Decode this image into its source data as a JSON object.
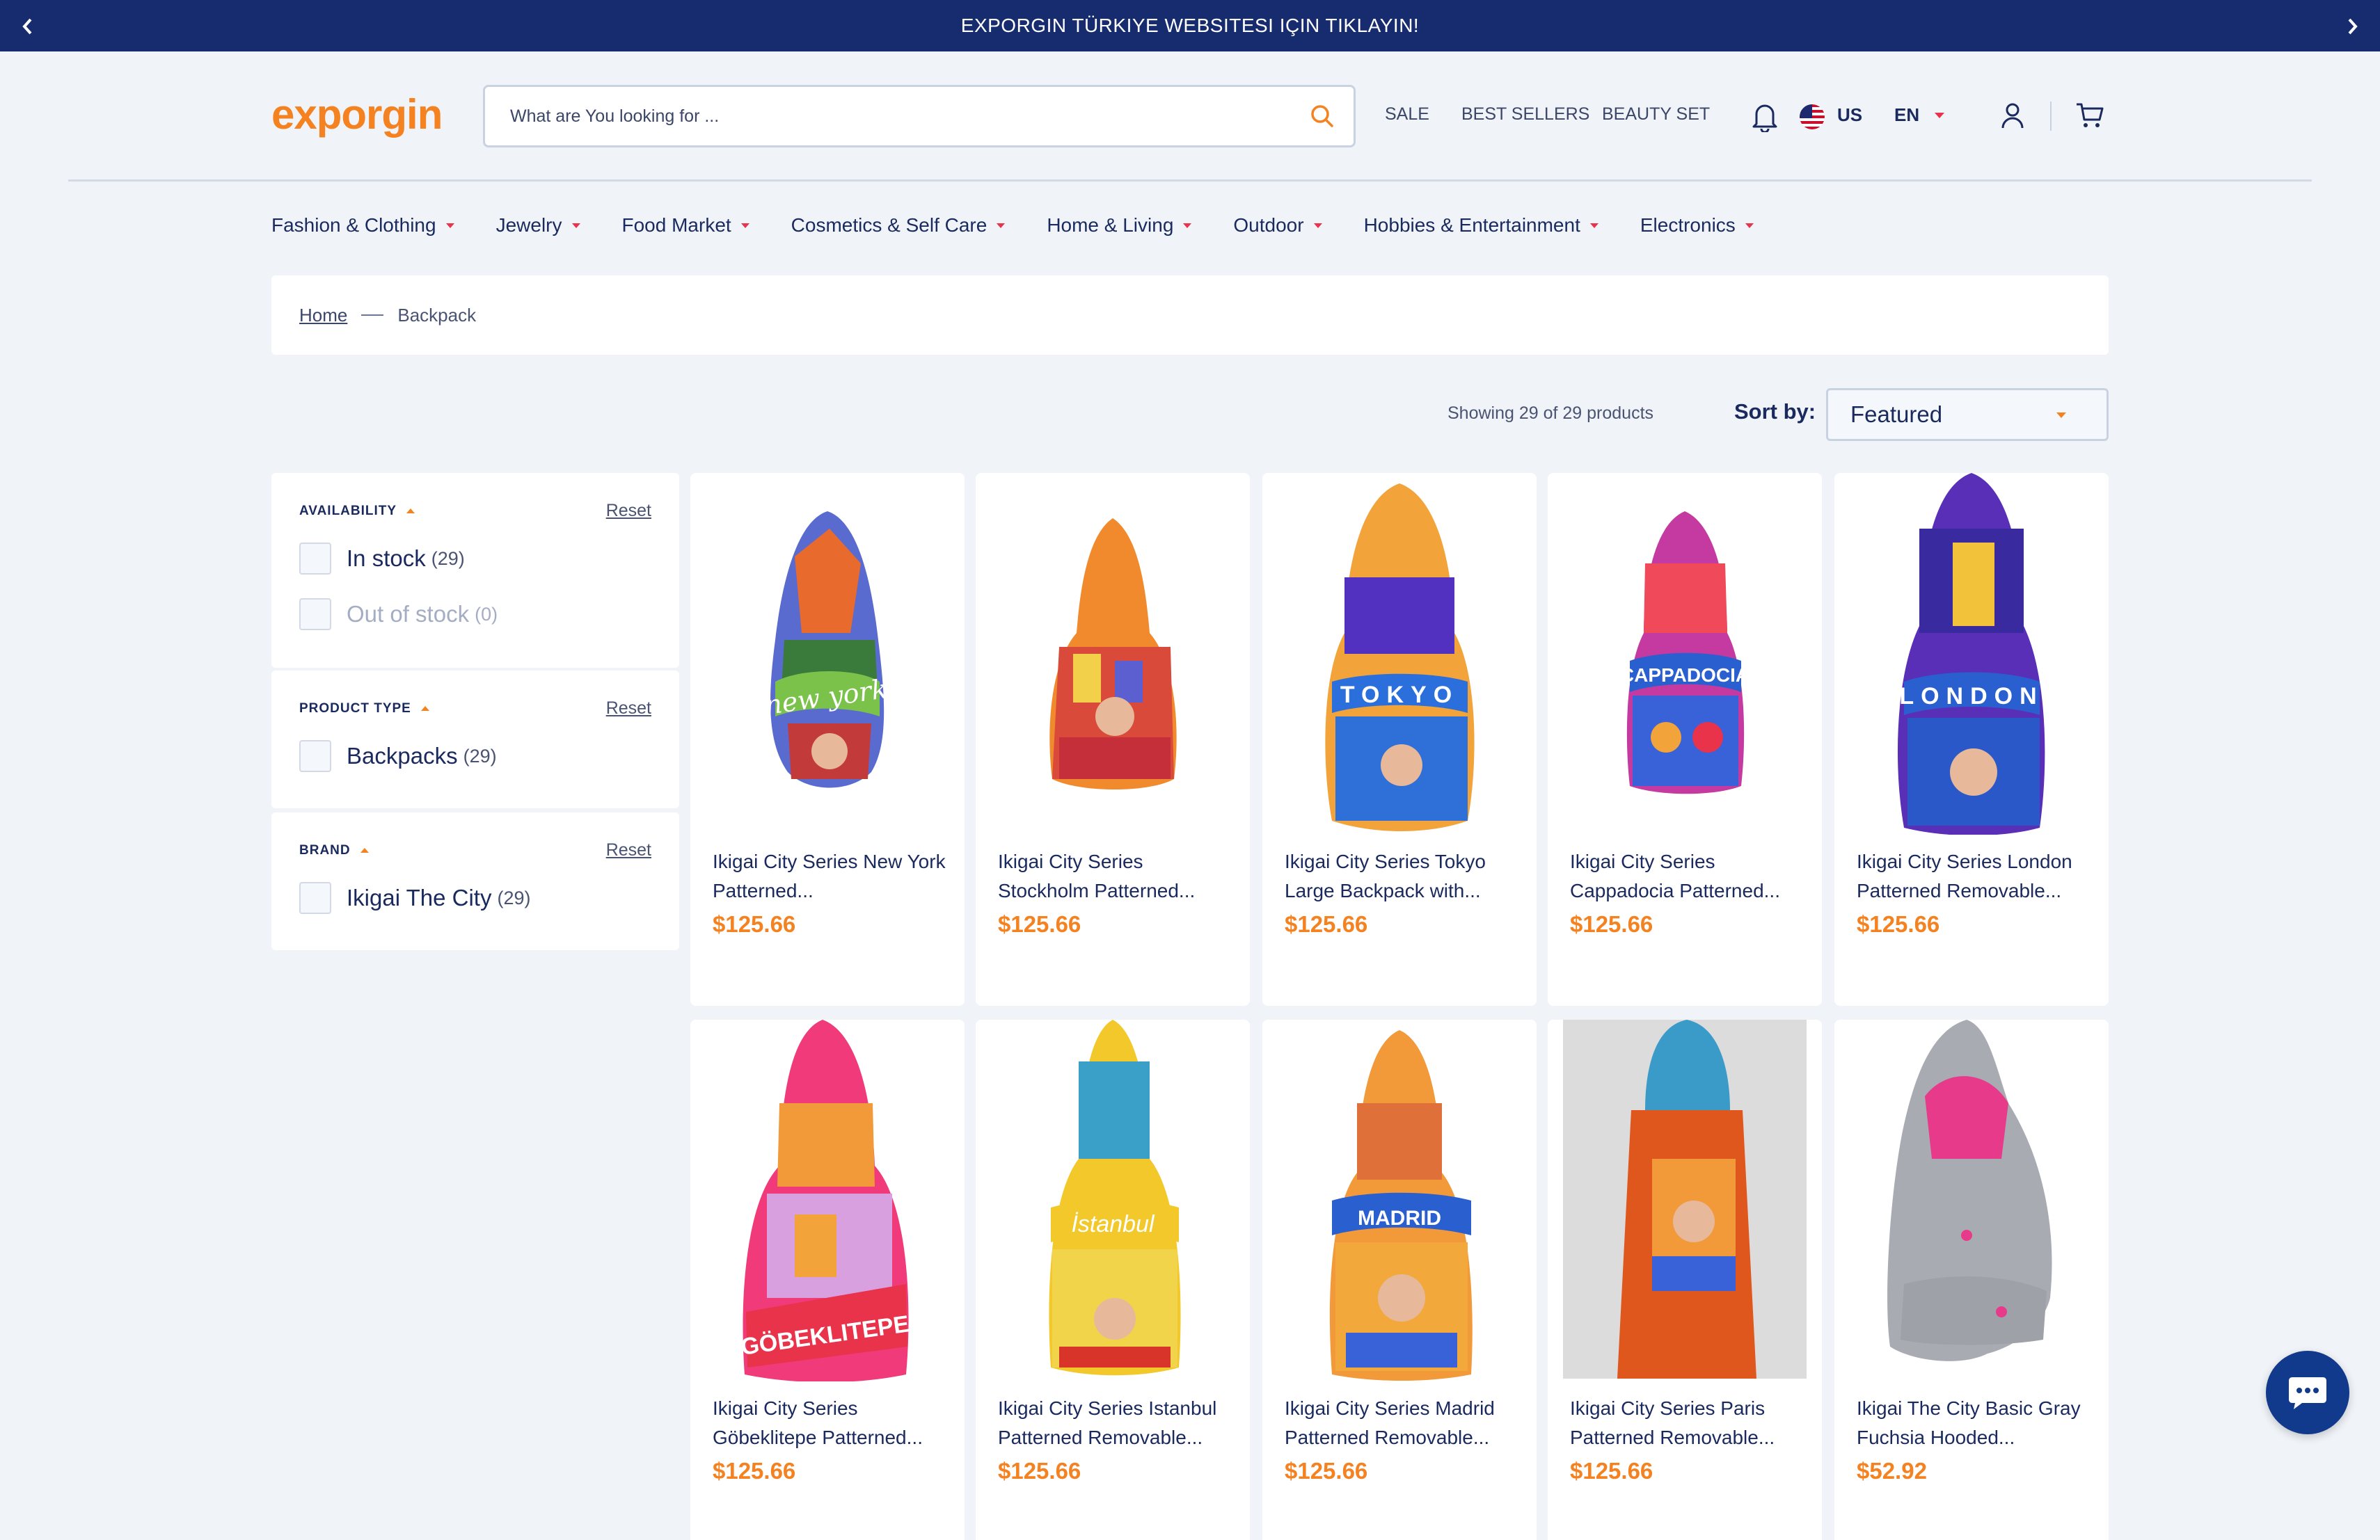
{
  "announcement": {
    "text": "EXPORGIN TÜRKIYE WEBSITESI IÇIN TIKLAYIN!"
  },
  "header": {
    "logo": "exporgin",
    "search_placeholder": "What are You looking for ...",
    "links": [
      "SALE",
      "BEST SELLERS",
      "BEAUTY SET"
    ],
    "country": "US",
    "language": "EN"
  },
  "categories": [
    "Fashion & Clothing",
    "Jewelry",
    "Food Market",
    "Cosmetics & Self Care",
    "Home & Living",
    "Outdoor",
    "Hobbies & Entertainment",
    "Electronics"
  ],
  "breadcrumb": {
    "home": "Home",
    "current": "Backpack"
  },
  "toolbar": {
    "showing": "Showing 29 of 29 products",
    "sort_label": "Sort by:",
    "sort_value": "Featured"
  },
  "filters": {
    "availability": {
      "title": "AVAILABILITY",
      "reset": "Reset",
      "in_stock": "In stock",
      "in_stock_count": "(29)",
      "out_stock": "Out of stock",
      "out_stock_count": "(0)"
    },
    "product_type": {
      "title": "PRODUCT TYPE",
      "reset": "Reset",
      "backpacks": "Backpacks",
      "backpacks_count": "(29)"
    },
    "brand": {
      "title": "BRAND",
      "reset": "Reset",
      "ikigai": "Ikigai The City",
      "ikigai_count": "(29)"
    }
  },
  "products": [
    {
      "title": "Ikigai City Series New York Patterned...",
      "price": "$125.66"
    },
    {
      "title": "Ikigai City Series Stockholm Patterned...",
      "price": "$125.66"
    },
    {
      "title": "Ikigai City Series Tokyo Large Backpack with...",
      "price": "$125.66"
    },
    {
      "title": "Ikigai City Series Cappadocia Patterned...",
      "price": "$125.66"
    },
    {
      "title": "Ikigai City Series London Patterned Removable...",
      "price": "$125.66"
    },
    {
      "title": "Ikigai City Series Göbeklitepe Patterned...",
      "price": "$125.66"
    },
    {
      "title": "Ikigai City Series Istanbul Patterned Removable...",
      "price": "$125.66"
    },
    {
      "title": "Ikigai City Series Madrid Patterned Removable...",
      "price": "$125.66"
    },
    {
      "title": "Ikigai City Series Paris Patterned Removable...",
      "price": "$125.66"
    },
    {
      "title": "Ikigai The City Basic Gray Fuchsia Hooded...",
      "price": "$52.92"
    }
  ],
  "image_labels": [
    "new york",
    "TOKYO",
    "CAPPADOCIA",
    "LONDON",
    "GÖBEKLITEPE",
    "İstanbul",
    "MADRID"
  ],
  "colors": {
    "navy": "#162c6e",
    "accent": "#f58220",
    "caret": "#e8334a"
  }
}
